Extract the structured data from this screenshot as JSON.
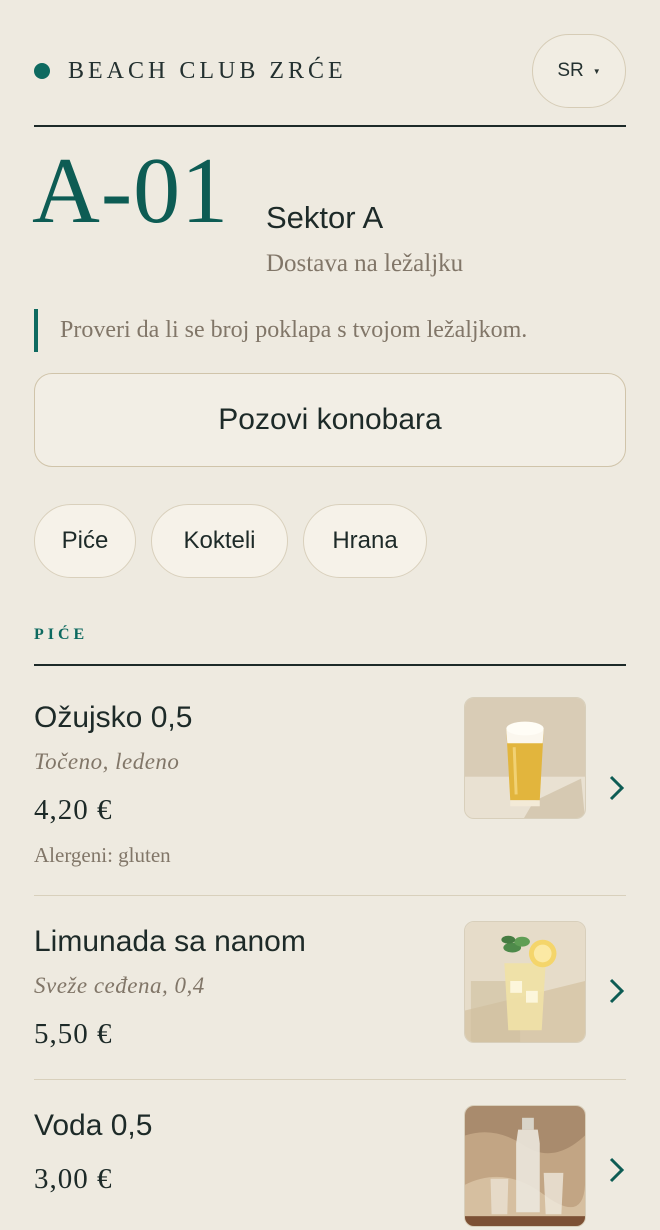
{
  "header": {
    "brand": "BEACH CLUB ZRĆE",
    "language": "SR"
  },
  "seat": {
    "code": "A-01",
    "sector": "Sektor A",
    "delivery": "Dostava na ležaljku",
    "notice": "Proveri da li se broj poklapa s tvojom ležaljkom."
  },
  "call_waiter_label": "Pozovi konobara",
  "tabs": [
    "Piće",
    "Kokteli",
    "Hrana"
  ],
  "section_title": "PIĆE",
  "items": [
    {
      "name": "Ožujsko 0,5",
      "desc": "Točeno, ledeno",
      "price": "4,20 €",
      "allergens": "Alergeni: gluten",
      "image": "beer-glass"
    },
    {
      "name": "Limunada sa nanom",
      "desc": "Sveže ceđena, 0,4",
      "price": "5,50 €",
      "allergens": "",
      "image": "lemonade-glass"
    },
    {
      "name": "Voda 0,5",
      "desc": "",
      "price": "3,00 €",
      "allergens": "",
      "image": "water-bottle"
    }
  ],
  "colors": {
    "accent": "#0e6a60",
    "background": "#eeeae0",
    "muted": "#817668"
  }
}
